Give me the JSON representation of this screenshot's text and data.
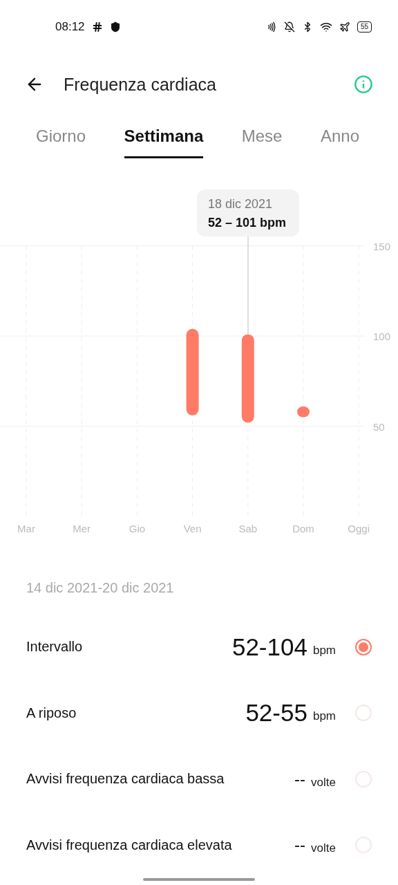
{
  "status_bar": {
    "time": "08:12",
    "battery": "55"
  },
  "header": {
    "title": "Frequenza cardiaca"
  },
  "tabs": [
    {
      "label": "Giorno",
      "selected": false
    },
    {
      "label": "Settimana",
      "selected": true
    },
    {
      "label": "Mese",
      "selected": false
    },
    {
      "label": "Anno",
      "selected": false
    }
  ],
  "chart": {
    "tooltip": {
      "date": "18 dic 2021",
      "value": "52 – 101 bpm"
    },
    "chart_data": {
      "type": "candlestick",
      "grid": true,
      "categories": [
        "Mar",
        "Mer",
        "Gio",
        "Ven",
        "Sab",
        "Dom",
        "Oggi"
      ],
      "ylim": [
        0,
        150
      ],
      "yticks": [
        50,
        100,
        150
      ],
      "series": [
        {
          "color": "#ff7b66",
          "ohlc": [
            null,
            null,
            null,
            [
              56,
              104,
              56,
              104
            ],
            [
              52,
              101,
              52,
              101
            ],
            [
              55,
              61,
              55,
              61
            ],
            null
          ]
        }
      ]
    }
  },
  "period": "14 dic 2021-20 dic 2021",
  "stats": [
    {
      "label": "Intervallo",
      "value": "52-104",
      "unit": "bpm",
      "selected": true
    },
    {
      "label": "A riposo",
      "value": "52-55",
      "unit": "bpm",
      "selected": false
    },
    {
      "label": "Avvisi frequenza cardiaca bassa",
      "value": "--",
      "unit": "volte",
      "selected": false
    },
    {
      "label": "Avvisi frequenza cardiaca elevata",
      "value": "--",
      "unit": "volte",
      "selected": false
    }
  ]
}
